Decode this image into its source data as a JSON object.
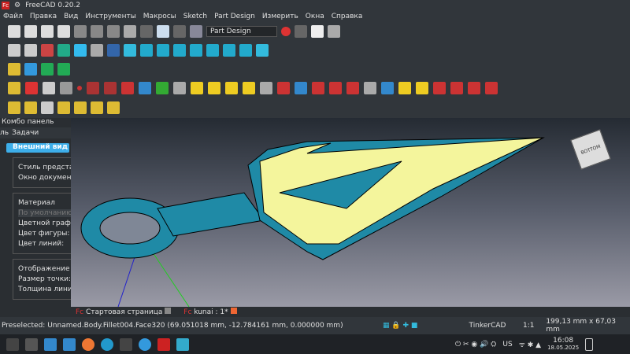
{
  "window": {
    "title": "FreeCAD 0.20.2",
    "logo": "Fc"
  },
  "menu": [
    "Файл",
    "Правка",
    "Вид",
    "Инструменты",
    "Макросы",
    "Sketch",
    "Part Design",
    "Измерить",
    "Окна",
    "Справка"
  ],
  "toolbar": {
    "workbench": "Part Design"
  },
  "combo": {
    "title": "Комбо панель",
    "tab_model": "ль",
    "tab_tasks": "Задачи",
    "section": "Внешний вид",
    "style_group": "Стиль представления",
    "doc_window": "Окно документа:",
    "material_group": "Материал",
    "material_value": "По умолчанию",
    "color_plot": "Цветной график:",
    "shape_color": "Цвет фигуры:",
    "line_color": "Цвет линий:",
    "display_group": "Отображение",
    "point_size": "Размер точки:",
    "line_width": "Толщина линии:"
  },
  "doc_tabs": [
    {
      "label": "Стартовая страница"
    },
    {
      "label": "kunai : 1*"
    }
  ],
  "status": {
    "preselected": "Preselected: Unnamed.Body.Fillet004.Face320 (69.051018 mm, -12.784161 mm, 0.000000 mm)",
    "nav_style": "TinkerCAD",
    "scale": "1:1",
    "dimensions": "199,13 mm x 67,03 mm"
  },
  "navcube": {
    "face": "BOTTOM"
  },
  "taskbar": {
    "time": "16:08",
    "date": "18.05.2025",
    "lang": "US"
  },
  "colors": {
    "accent": "#3daee9",
    "model": "#1f8aa6",
    "face": "#f4f59c"
  }
}
